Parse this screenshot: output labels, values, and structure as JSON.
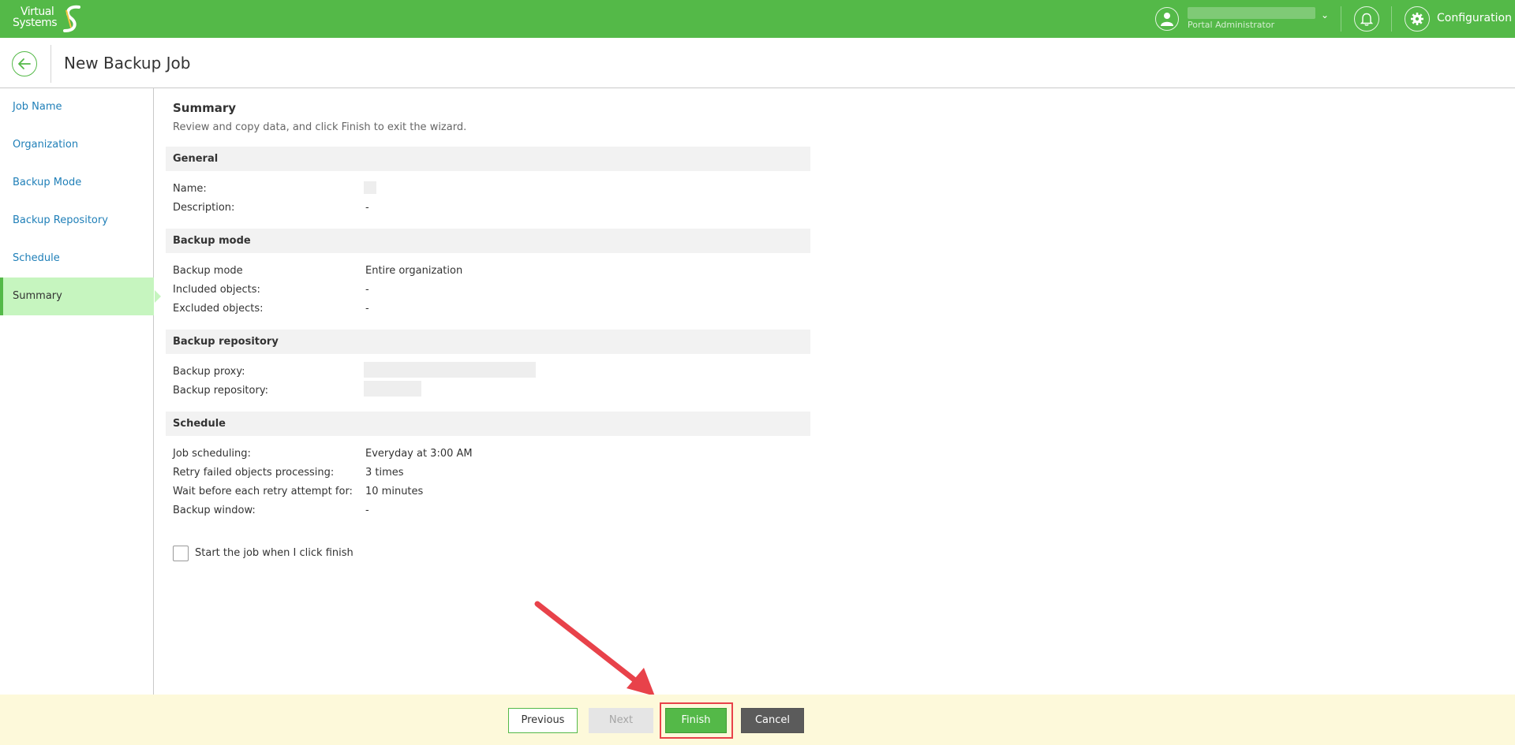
{
  "app": {
    "logo_line1": "Virtual",
    "logo_line2": "Systems",
    "user_role": "Portal Administrator",
    "config_label": "Configuration"
  },
  "header": {
    "title": "New Backup Job"
  },
  "sidebar": {
    "items": [
      {
        "label": "Job Name"
      },
      {
        "label": "Organization"
      },
      {
        "label": "Backup Mode"
      },
      {
        "label": "Backup Repository"
      },
      {
        "label": "Schedule"
      },
      {
        "label": "Summary"
      }
    ]
  },
  "summary": {
    "title": "Summary",
    "subtitle": "Review and copy data, and click Finish to exit the wizard.",
    "general": {
      "heading": "General",
      "name_label": "Name:",
      "description_label": "Description:",
      "description_value": "-"
    },
    "backup_mode": {
      "heading": "Backup mode",
      "mode_label": "Backup mode",
      "mode_value": "Entire organization",
      "included_label": "Included objects:",
      "included_value": "-",
      "excluded_label": "Excluded objects:",
      "excluded_value": "-"
    },
    "backup_repository": {
      "heading": "Backup repository",
      "proxy_label": "Backup proxy:",
      "repository_label": "Backup repository:"
    },
    "schedule": {
      "heading": "Schedule",
      "scheduling_label": "Job scheduling:",
      "scheduling_value": "Everyday at 3:00 AM",
      "retry_label": "Retry failed objects processing:",
      "retry_value": "3 times",
      "wait_label": "Wait before each retry attempt for:",
      "wait_value": "10 minutes",
      "window_label": "Backup window:",
      "window_value": "-"
    },
    "start_checkbox_label": "Start the job when I click finish"
  },
  "footer": {
    "previous_label": "Previous",
    "next_label": "Next",
    "finish_label": "Finish",
    "cancel_label": "Cancel"
  },
  "colors": {
    "brand_green": "#54b948",
    "link_blue": "#1f7fb8",
    "active_nav_bg": "#c6f5bf",
    "footer_bg": "#fdf9da",
    "highlight_red": "#e8424a"
  },
  "icons": [
    "user-icon",
    "chevron-down-icon",
    "bell-icon",
    "gear-icon",
    "arrow-left-icon"
  ]
}
